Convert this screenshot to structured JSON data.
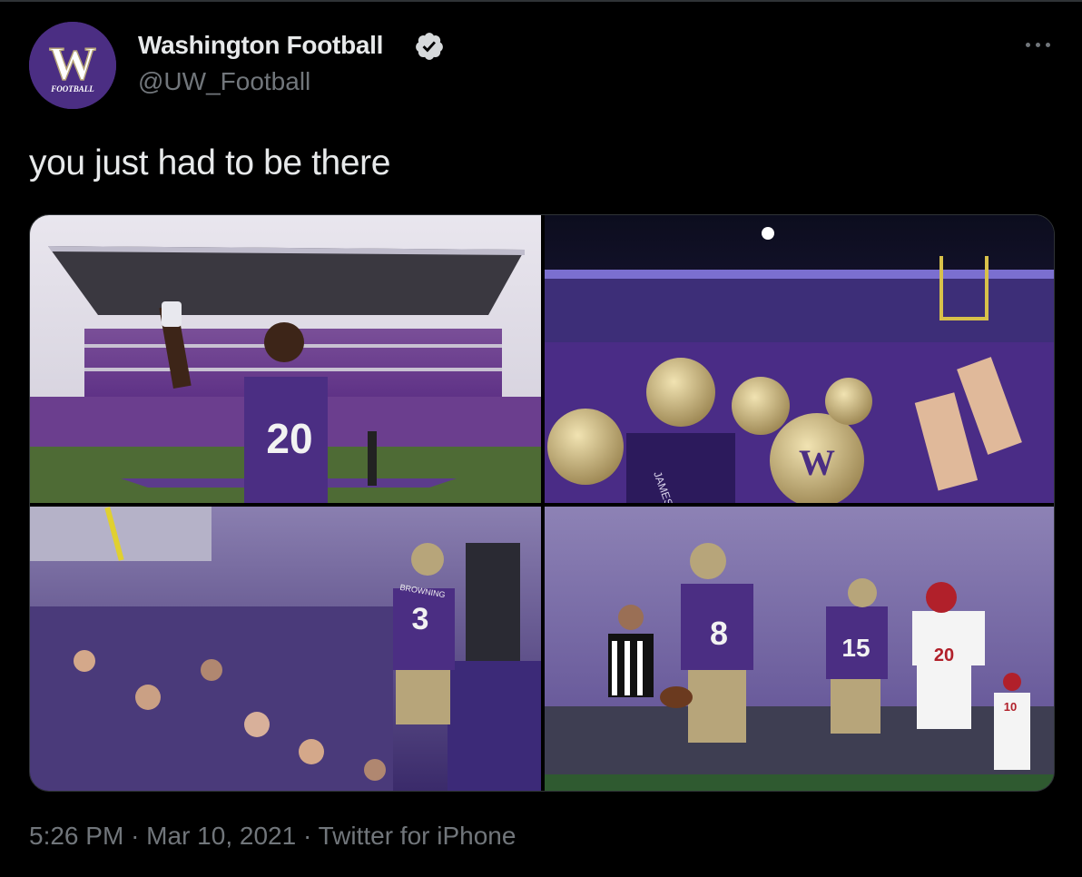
{
  "tweet": {
    "author": {
      "display_name": "Washington Football",
      "handle": "@UW_Football",
      "verified": true,
      "avatar_letter": "W",
      "avatar_caption": "FOOTBALL",
      "avatar_color": "#4b2e83"
    },
    "text": "you just had to be there",
    "time": "5:26 PM",
    "separator": "·",
    "date": "Mar 10, 2021",
    "source": "Twitter for iPhone",
    "more_icon": "more-horizontal-icon",
    "photos": [
      {
        "jersey_number": "20"
      },
      {
        "helmet_letter": "W",
        "jersey_name": "JAMES"
      },
      {
        "jersey_number": "3",
        "jersey_name": "BROWNING"
      },
      {
        "jersey_numbers": [
          "8",
          "15",
          "20",
          "10"
        ]
      }
    ]
  },
  "colors": {
    "background": "#000000",
    "primary_text": "#e7e9ea",
    "secondary_text": "#71767b",
    "uw_purple": "#4b2e83",
    "uw_gold": "#b7a57a"
  }
}
